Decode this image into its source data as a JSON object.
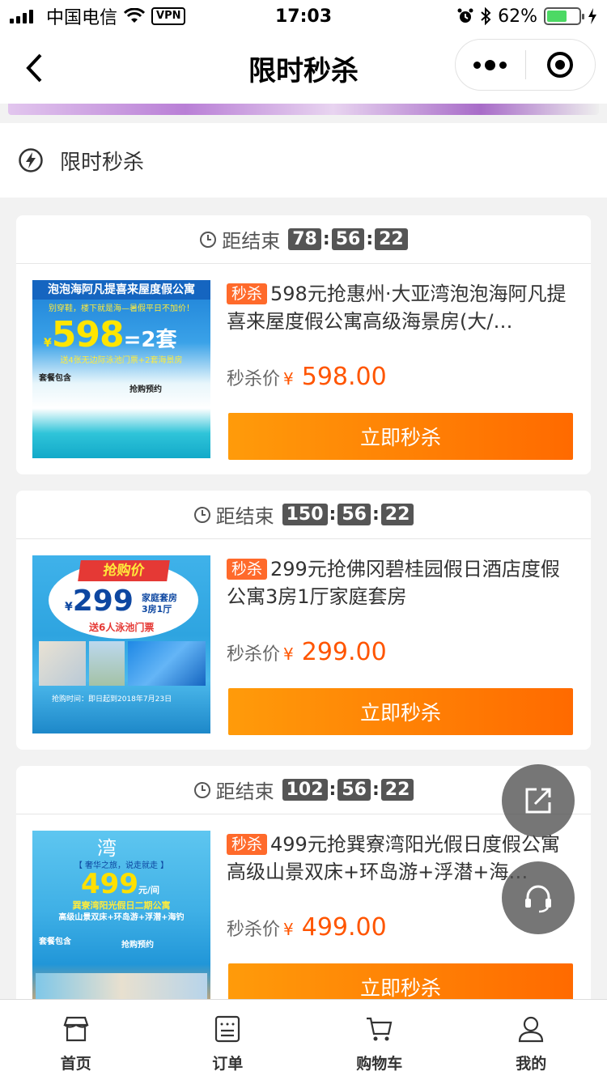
{
  "status_bar": {
    "carrier": "中国电信",
    "vpn": "VPN",
    "time": "17:03",
    "battery": "62%",
    "battery_level": 0.62
  },
  "nav": {
    "title": "限时秒杀"
  },
  "section": {
    "title": "限时秒杀",
    "icon": "lightning-icon"
  },
  "products": [
    {
      "countdown_label": "距结束",
      "hours": "78",
      "minutes": "56",
      "seconds": "22",
      "tag": "秒杀",
      "title": "598元抢惠州·大亚湾泡泡海阿凡提喜来屋度假公寓高级海景房(大/…",
      "price_label": "秒杀价",
      "currency": "¥",
      "price": "598.00",
      "button": "立即秒杀",
      "image": {
        "banner": "泡泡海阿凡提喜来屋度假公寓",
        "sub": "别穿鞋，楼下就是海—暑假平日不加价！",
        "price_big": "598",
        "price_suffix": "=2套",
        "note": "送4张无边际泳池门票+2套海景房",
        "pkg_title": "套餐包含",
        "buy_title": "抢购预约",
        "currency_mark": "¥"
      }
    },
    {
      "countdown_label": "距结束",
      "hours": "150",
      "minutes": "56",
      "seconds": "22",
      "tag": "秒杀",
      "title": "299元抢佛冈碧桂园假日酒店度假公寓3房1厅家庭套房",
      "price_label": "秒杀价",
      "currency": "¥",
      "price": "299.00",
      "button": "立即秒杀",
      "image": {
        "banner": "抢购价",
        "price_big": "299",
        "room": "家庭套房",
        "room2": "3房1厅",
        "note": "送6人泳池门票",
        "info": "抢购时间：即日起到2018年7月23日",
        "currency_mark": "¥"
      }
    },
    {
      "countdown_label": "距结束",
      "hours": "102",
      "minutes": "56",
      "seconds": "22",
      "tag": "秒杀",
      "title": "499元抢巽寮湾阳光假日度假公寓高级山景双床+环岛游+浮潜+海…",
      "price_label": "秒杀价",
      "currency": "¥",
      "price": "499.00",
      "button": "立即秒杀",
      "image": {
        "head": "湾",
        "slogan": "【 奢华之旅，说走就走 】",
        "price_big": "499",
        "unit": "元/间",
        "name": "巽寮湾阳光假日二期公寓",
        "note": "高级山景双床+环岛游+浮潜+海钓",
        "pkg_title": "套餐包含",
        "buy_title": "抢购预约"
      }
    }
  ],
  "tabs": [
    {
      "label": "首页",
      "icon": "store-icon"
    },
    {
      "label": "订单",
      "icon": "order-list-icon"
    },
    {
      "label": "购物车",
      "icon": "cart-icon"
    },
    {
      "label": "我的",
      "icon": "user-icon"
    }
  ],
  "colors": {
    "accent": "#ff5500",
    "button_start": "#ff9b0a",
    "button_end": "#ff6a00",
    "tag": "#ff6a2b",
    "countdown_box": "#555555"
  }
}
